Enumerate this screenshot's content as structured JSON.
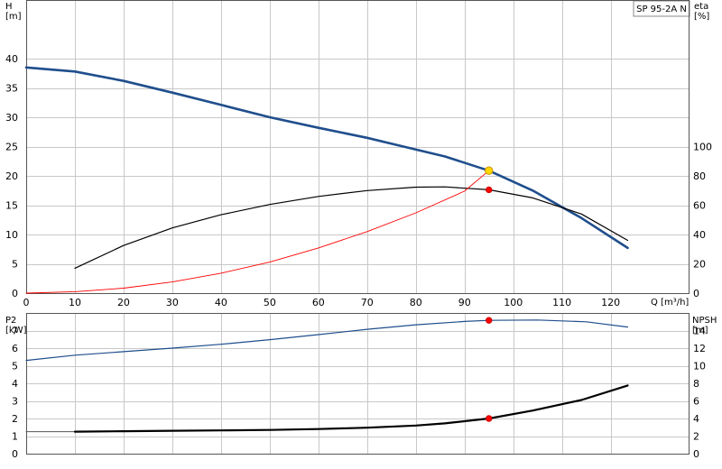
{
  "badge": {
    "model": "SP 95-2A N"
  },
  "chart_data": [
    {
      "type": "line",
      "panel": "head-efficiency",
      "xlabel": "Q [m³/h]",
      "x_ticks": [
        0,
        10,
        20,
        30,
        40,
        50,
        60,
        70,
        80,
        90,
        100,
        110,
        120
      ],
      "xlim": [
        0,
        136
      ],
      "left_axis": {
        "label_top": "H",
        "label_unit": "[m]",
        "ylim": [
          0,
          50
        ],
        "ticks": [
          0,
          5,
          10,
          15,
          20,
          25,
          30,
          35,
          40
        ]
      },
      "right_axis": {
        "label_top": "eta",
        "label_unit": "[%]",
        "ylim": [
          0,
          200
        ],
        "ticks": [
          0,
          20,
          40,
          60,
          80,
          100
        ]
      },
      "series": [
        {
          "axis": "left",
          "color": "#1f4e8c",
          "width": 2.6,
          "x": [
            0,
            10,
            20,
            30,
            40,
            50,
            60,
            70,
            76,
            86,
            95,
            104,
            114,
            123.5
          ],
          "y": [
            38.5,
            37.8,
            36.2,
            34.2,
            32.1,
            30.0,
            28.2,
            26.5,
            25.3,
            23.3,
            20.9,
            17.5,
            12.8,
            7.7
          ]
        },
        {
          "axis": "right",
          "color": "#000000",
          "width": 1.2,
          "x": [
            10,
            20,
            30,
            40,
            50,
            60,
            70,
            80,
            86,
            95,
            104,
            114,
            123.5
          ],
          "y": [
            17,
            32.5,
            44.5,
            53.5,
            60.5,
            66,
            70,
            72.3,
            72.5,
            70.5,
            65,
            54,
            36
          ]
        },
        {
          "axis": "left",
          "color": "#ff0000",
          "width": 0.9,
          "x": [
            0,
            10,
            20,
            30,
            40,
            50,
            60,
            70,
            80,
            90,
            95
          ],
          "y": [
            0,
            0.25,
            0.85,
            1.9,
            3.4,
            5.3,
            7.7,
            10.5,
            13.7,
            17.4,
            20.9
          ]
        }
      ],
      "markers": [
        {
          "axis": "left",
          "x": 95,
          "y": 20.9,
          "color": "#ffd700",
          "stroke": "#c89600",
          "r": 4.2
        },
        {
          "axis": "right",
          "x": 95,
          "y": 70.5,
          "color": "#ff0000",
          "stroke": "#cc0000",
          "r": 3.2
        }
      ]
    },
    {
      "type": "line",
      "panel": "power-npsh",
      "xlim": [
        0,
        136
      ],
      "left_axis": {
        "label_top": "P2",
        "label_unit": "[kW]",
        "ylim": [
          0,
          8
        ],
        "ticks": [
          0,
          1,
          2,
          3,
          4,
          5,
          6,
          7
        ]
      },
      "right_axis": {
        "label_top": "NPSH",
        "label_unit": "[m]",
        "ylim": [
          0,
          16
        ],
        "ticks": [
          0,
          2,
          4,
          6,
          8,
          10,
          12,
          14
        ]
      },
      "series": [
        {
          "axis": "left",
          "color": "#1f4e8c",
          "width": 1.2,
          "x": [
            0,
            10,
            20,
            30,
            40,
            50,
            60,
            70,
            80,
            90,
            95,
            105,
            115,
            123.5
          ],
          "y": [
            5.3,
            5.6,
            5.8,
            6.0,
            6.22,
            6.48,
            6.77,
            7.07,
            7.33,
            7.52,
            7.58,
            7.6,
            7.5,
            7.2
          ]
        },
        {
          "axis": "left",
          "color": "#555555",
          "width": 1.0,
          "x": [
            0,
            10
          ],
          "y": [
            1.25,
            1.25
          ]
        },
        {
          "axis": "right",
          "color": "#000000",
          "width": 2.2,
          "x": [
            10,
            20,
            30,
            40,
            50,
            60,
            70,
            80,
            86,
            95,
            104,
            114,
            123.5
          ],
          "y": [
            2.5,
            2.55,
            2.6,
            2.65,
            2.7,
            2.8,
            2.95,
            3.2,
            3.45,
            4.0,
            4.9,
            6.1,
            7.75
          ]
        }
      ],
      "markers": [
        {
          "axis": "left",
          "x": 95,
          "y": 7.58,
          "color": "#ff0000",
          "stroke": "#cc0000",
          "r": 3.2
        },
        {
          "axis": "right",
          "x": 95,
          "y": 4.0,
          "color": "#ff0000",
          "stroke": "#cc0000",
          "r": 3.2
        }
      ]
    }
  ]
}
